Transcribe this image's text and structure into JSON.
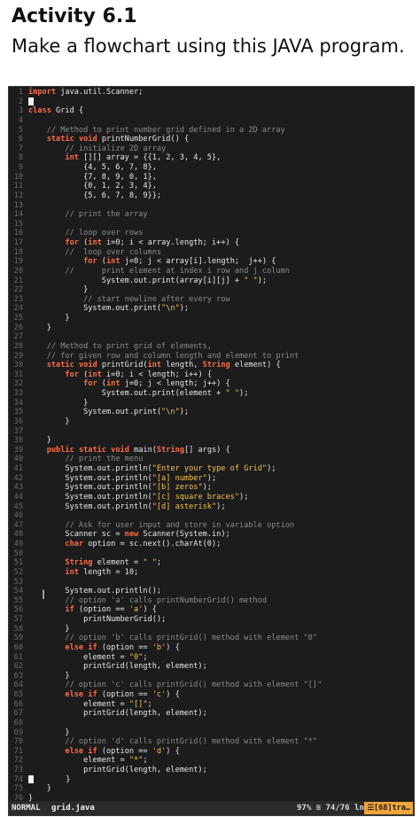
{
  "header": {
    "title": "Activity 6.1",
    "subtitle": "Make a flowchart using this JAVA program."
  },
  "editor": {
    "lines": [
      {
        "n": "1",
        "t": "import java.util.Scanner;"
      },
      {
        "n": "2",
        "t": "█"
      },
      {
        "n": "3",
        "t": "class Grid {"
      },
      {
        "n": "4",
        "t": ""
      },
      {
        "n": "5",
        "t": "    // Method to print number grid defined in a 2D array"
      },
      {
        "n": "6",
        "t": "    static void printNumberGrid() {"
      },
      {
        "n": "7",
        "t": "        // initialize 2D array"
      },
      {
        "n": "8",
        "t": "        int [][] array = {{1, 2, 3, 4, 5},"
      },
      {
        "n": "9",
        "t": "            {4, 5, 6, 7, 8},"
      },
      {
        "n": "10",
        "t": "            {7, 8, 9, 0, 1},"
      },
      {
        "n": "11",
        "t": "            {0, 1, 2, 3, 4},"
      },
      {
        "n": "12",
        "t": "            {5, 6, 7, 8, 9}};"
      },
      {
        "n": "13",
        "t": ""
      },
      {
        "n": "14",
        "t": "        // print the array"
      },
      {
        "n": "15",
        "t": ""
      },
      {
        "n": "16",
        "t": "        // loop over rows"
      },
      {
        "n": "17",
        "t": "        for (int i=0; i < array.length; i++) {"
      },
      {
        "n": "18",
        "t": "        //  loop over columns"
      },
      {
        "n": "19",
        "t": "            for (int j=0; j < array[i].length;  j++) {"
      },
      {
        "n": "20",
        "t": "        //      print element at index i row and j column"
      },
      {
        "n": "21",
        "t": "                System.out.print(array[i][j] + \" \");"
      },
      {
        "n": "22",
        "t": "            }"
      },
      {
        "n": "23",
        "t": "            // start newline after every row"
      },
      {
        "n": "24",
        "t": "            System.out.print(\"\\n\");"
      },
      {
        "n": "25",
        "t": "        }"
      },
      {
        "n": "26",
        "t": "    }"
      },
      {
        "n": "27",
        "t": ""
      },
      {
        "n": "28",
        "t": "    // Method to print grid of elements,"
      },
      {
        "n": "29",
        "t": "    // for given row and column length and element to print"
      },
      {
        "n": "30",
        "t": "    static void printGrid(int length, String element) {"
      },
      {
        "n": "31",
        "t": "        for (int i=0; i < length; i++) {"
      },
      {
        "n": "32",
        "t": "            for (int j=0; j < length; j++) {"
      },
      {
        "n": "33",
        "t": "                System.out.print(element + \" \");"
      },
      {
        "n": "34",
        "t": "            }"
      },
      {
        "n": "35",
        "t": "            System.out.print(\"\\n\");"
      },
      {
        "n": "36",
        "t": "        }"
      },
      {
        "n": "37",
        "t": ""
      },
      {
        "n": "38",
        "t": "    }"
      },
      {
        "n": "39",
        "t": "    public static void main(String[] args) {"
      },
      {
        "n": "40",
        "t": "        // print the menu"
      },
      {
        "n": "41",
        "t": "        System.out.println(\"Enter your type of Grid\");"
      },
      {
        "n": "42",
        "t": "        System.out.println(\"[a] number\");"
      },
      {
        "n": "43",
        "t": "        System.out.println(\"[b] zeros\");"
      },
      {
        "n": "44",
        "t": "        System.out.println(\"[c] square braces\");"
      },
      {
        "n": "45",
        "t": "        System.out.println(\"[d] asterisk\");"
      },
      {
        "n": "46",
        "t": ""
      },
      {
        "n": "47",
        "t": "        // Ask for user input and store in variable option"
      },
      {
        "n": "48",
        "t": "        Scanner sc = new Scanner(System.in);"
      },
      {
        "n": "49",
        "t": "        char option = sc.next().charAt(0);"
      },
      {
        "n": "50",
        "t": ""
      },
      {
        "n": "51",
        "t": "        String element = \" \";"
      },
      {
        "n": "52",
        "t": "        int length = 10;"
      },
      {
        "n": "53",
        "t": ""
      },
      {
        "n": "54",
        "t": "        System.out.println();"
      },
      {
        "n": "55",
        "t": "        // option 'a' calls printNumberGrid() method"
      },
      {
        "n": "56",
        "t": "        if (option == 'a') {"
      },
      {
        "n": "57",
        "t": "            printNumberGrid();"
      },
      {
        "n": "58",
        "t": "        }"
      },
      {
        "n": "59",
        "t": "        // option 'b' calls printGrid() method with element \"0\""
      },
      {
        "n": "60",
        "t": "        else if (option == 'b') {"
      },
      {
        "n": "61",
        "t": "            element = \"0\";"
      },
      {
        "n": "62",
        "t": "            printGrid(length, element);"
      },
      {
        "n": "63",
        "t": "        }"
      },
      {
        "n": "64",
        "t": "        // option 'c' calls printGrid() method with element \"[]\""
      },
      {
        "n": "65",
        "t": "        else if (option == 'c') {"
      },
      {
        "n": "66",
        "t": "            element = \"[]\";"
      },
      {
        "n": "67",
        "t": "            printGrid(length, element);"
      },
      {
        "n": "68",
        "t": ""
      },
      {
        "n": "69",
        "t": "        }"
      },
      {
        "n": "70",
        "t": "        // option 'd' calls printGrid() method with element \"*\""
      },
      {
        "n": "71",
        "t": "        else if (option == 'd') {"
      },
      {
        "n": "72",
        "t": "            element = \"*\";"
      },
      {
        "n": "73",
        "t": "            printGrid(length, element);"
      },
      {
        "n": "74",
        "t": "█       }"
      },
      {
        "n": "75",
        "t": "    }"
      },
      {
        "n": "76",
        "t": "}"
      }
    ]
  },
  "statusbar": {
    "mode": "NORMAL",
    "filename": "grid.java",
    "position": "97% ≡ 74/76 ln :1",
    "filetype": "☰[68]tra…"
  },
  "colors": {
    "background": "#1c1c1c",
    "keyword": "#ff6b4a",
    "comment": "#8b8b8b",
    "string": "#f2c250",
    "filetype_badge": "#f2a53a"
  }
}
